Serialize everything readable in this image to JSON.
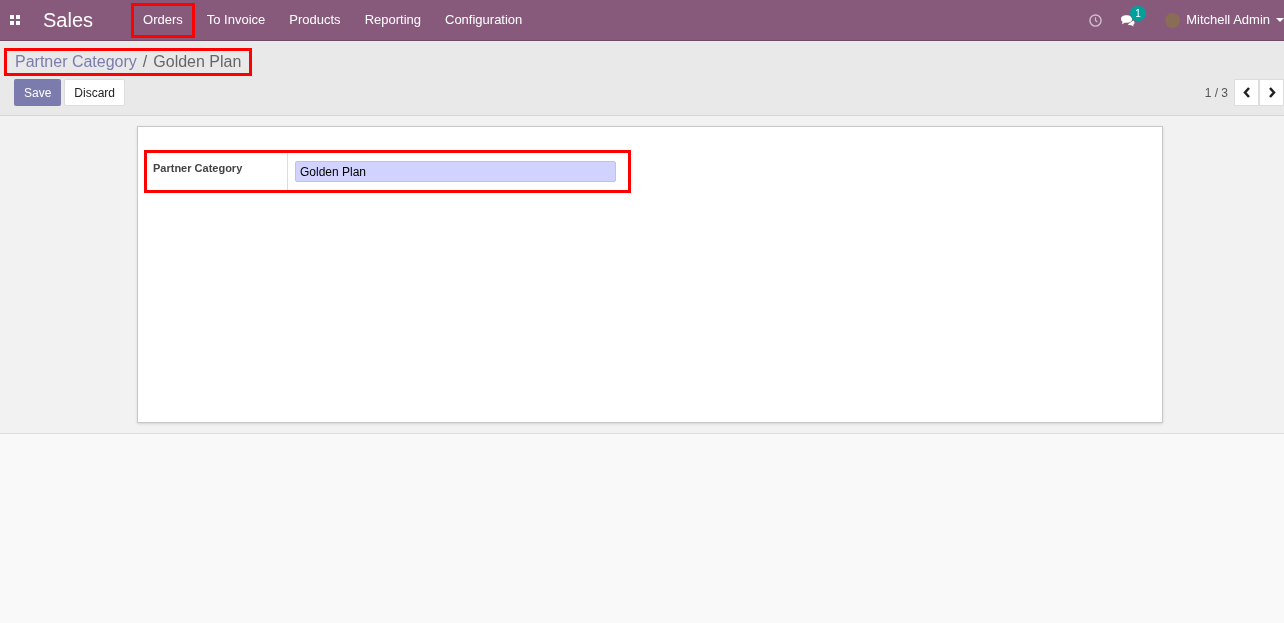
{
  "navbar": {
    "app_name": "Sales",
    "menu": [
      {
        "label": "Orders",
        "highlighted": true
      },
      {
        "label": "To Invoice",
        "highlighted": false
      },
      {
        "label": "Products",
        "highlighted": false
      },
      {
        "label": "Reporting",
        "highlighted": false
      },
      {
        "label": "Configuration",
        "highlighted": false
      }
    ],
    "message_count": "1",
    "user": "Mitchell Admin"
  },
  "breadcrumb": {
    "items": [
      "Partner Category",
      "Golden Plan"
    ],
    "separator": "/",
    "highlighted": true
  },
  "buttons": [
    "Save",
    "Discard"
  ],
  "pager": "1 / 3",
  "form": {
    "fields": [
      {
        "label": "Partner Category",
        "value": "Golden Plan",
        "focused": true,
        "highlighted": true
      }
    ]
  }
}
